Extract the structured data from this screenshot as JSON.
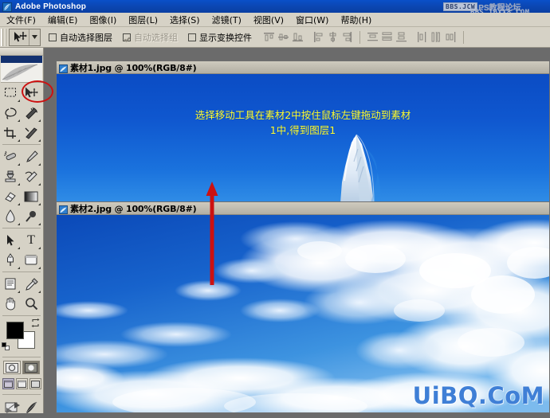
{
  "window": {
    "app_title": "Adobe Photoshop",
    "app_icon": "photoshop-feather-icon"
  },
  "watermark_top": {
    "badge": "BBS.JCW",
    "cn": "PS教程论坛",
    "url": "BBS.16XX8.COM"
  },
  "watermark_bottom": {
    "text": "UiBQ.CoM"
  },
  "menubar": {
    "items": [
      {
        "label": "文件(F)",
        "name": "menu-file"
      },
      {
        "label": "编辑(E)",
        "name": "menu-edit"
      },
      {
        "label": "图像(I)",
        "name": "menu-image"
      },
      {
        "label": "图层(L)",
        "name": "menu-layer"
      },
      {
        "label": "选择(S)",
        "name": "menu-select"
      },
      {
        "label": "滤镜(T)",
        "name": "menu-filter"
      },
      {
        "label": "视图(V)",
        "name": "menu-view"
      },
      {
        "label": "窗口(W)",
        "name": "menu-window"
      },
      {
        "label": "帮助(H)",
        "name": "menu-help"
      }
    ]
  },
  "options_bar": {
    "active_tool": "move-tool",
    "checkboxes": [
      {
        "label": "自动选择图层",
        "checked": false,
        "disabled": false
      },
      {
        "label": "自动选择组",
        "checked": true,
        "disabled": true
      },
      {
        "label": "显示变换控件",
        "checked": false,
        "disabled": false
      }
    ],
    "align_group_1": [
      "align-top-edges",
      "align-vertical-centers",
      "align-bottom-edges"
    ],
    "align_group_2": [
      "align-left-edges",
      "align-horizontal-centers",
      "align-right-edges"
    ],
    "distribute_group_1": [
      "distribute-top-edges",
      "distribute-vertical-centers",
      "distribute-bottom-edges"
    ],
    "distribute_group_2": [
      "distribute-left-edges",
      "distribute-horizontal-centers",
      "distribute-right-edges"
    ]
  },
  "toolbox": {
    "tools": [
      {
        "name": "marquee-tool",
        "glyph": "▭"
      },
      {
        "name": "move-tool",
        "glyph": "➤"
      },
      {
        "name": "lasso-tool",
        "glyph": "◯"
      },
      {
        "name": "magic-wand-tool",
        "glyph": "✦"
      },
      {
        "name": "crop-tool",
        "glyph": "⌗"
      },
      {
        "name": "slice-tool",
        "glyph": "✂"
      },
      {
        "name": "healing-brush-tool",
        "glyph": "✚"
      },
      {
        "name": "brush-tool",
        "glyph": "🖌"
      },
      {
        "name": "clone-stamp-tool",
        "glyph": "⚲"
      },
      {
        "name": "history-brush-tool",
        "glyph": "↺"
      },
      {
        "name": "eraser-tool",
        "glyph": "▱"
      },
      {
        "name": "gradient-tool",
        "glyph": "▦"
      },
      {
        "name": "blur-tool",
        "glyph": "💧"
      },
      {
        "name": "dodge-tool",
        "glyph": "●"
      },
      {
        "name": "path-selection-tool",
        "glyph": "➤"
      },
      {
        "name": "type-tool",
        "glyph": "T"
      },
      {
        "name": "pen-tool",
        "glyph": "✒"
      },
      {
        "name": "shape-tool",
        "glyph": "▭"
      },
      {
        "name": "notes-tool",
        "glyph": "▤"
      },
      {
        "name": "eyedropper-tool",
        "glyph": "⌁"
      },
      {
        "name": "hand-tool",
        "glyph": "✋"
      },
      {
        "name": "zoom-tool",
        "glyph": "🔍"
      }
    ],
    "highlighted_tool": "move-tool",
    "foreground_color": "#000000",
    "background_color": "#ffffff",
    "quick_mask": [
      "standard-mode",
      "quick-mask-mode"
    ],
    "screen_modes": [
      "standard-screen-mode",
      "full-screen-with-menubar",
      "full-screen-mode"
    ],
    "jump_to": "jump-to-imageready"
  },
  "documents": [
    {
      "title": "素材1.jpg @ 100%(RGB/8#)",
      "icon": "image-doc-icon",
      "annotation_line1": "选择移动工具在素材2中按住鼠标左键拖动到素材",
      "annotation_line2": "1中,得到图层1",
      "annotation_color": "#ffff33"
    },
    {
      "title": "素材2.jpg @ 100%(RGB/8#)",
      "icon": "image-doc-icon"
    }
  ],
  "annotations": {
    "red_arrow": {
      "name": "red-drag-arrow",
      "color": "#cc1111",
      "direction": "up"
    },
    "tool_highlight": {
      "name": "move-tool-highlight-ellipse",
      "color": "#cc1111"
    }
  }
}
